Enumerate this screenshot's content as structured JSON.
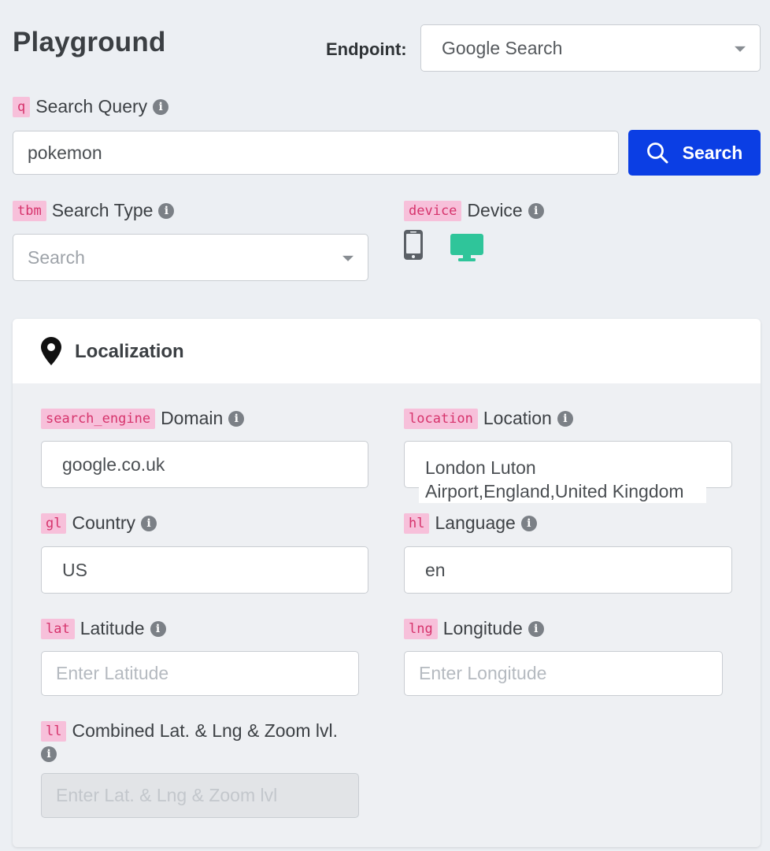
{
  "header": {
    "title": "Playground",
    "endpoint_label": "Endpoint:",
    "endpoint_value": "Google Search"
  },
  "query": {
    "tag": "q",
    "label": "Search Query",
    "value": "pokemon",
    "button_label": "Search"
  },
  "search_type": {
    "tag": "tbm",
    "label": "Search Type",
    "placeholder": "Search"
  },
  "device": {
    "tag": "device",
    "label": "Device",
    "options": [
      "mobile-icon",
      "desktop-icon"
    ],
    "selected": "desktop-icon",
    "selected_color": "#2fc59a"
  },
  "localization": {
    "title": "Localization",
    "domain": {
      "tag": "search_engine",
      "label": "Domain",
      "value": "google.co.uk"
    },
    "location": {
      "tag": "location",
      "label": "Location",
      "value_line1": "London Luton",
      "value_line2": "Airport,England,United Kingdom"
    },
    "country": {
      "tag": "gl",
      "label": "Country",
      "value": "US"
    },
    "language": {
      "tag": "hl",
      "label": "Language",
      "value": "en"
    },
    "latitude": {
      "tag": "lat",
      "label": "Latitude",
      "placeholder": "Enter Latitude"
    },
    "longitude": {
      "tag": "lng",
      "label": "Longitude",
      "placeholder": "Enter Longitude"
    },
    "combined": {
      "tag": "ll",
      "label": "Combined Lat. & Lng & Zoom lvl.",
      "placeholder": "Enter Lat. & Lng & Zoom lvl"
    }
  },
  "colors": {
    "accent": "#0b3ee4",
    "tag_bg": "#f7c0da",
    "tag_text": "#d6336c",
    "page_bg": "#eceff3"
  }
}
